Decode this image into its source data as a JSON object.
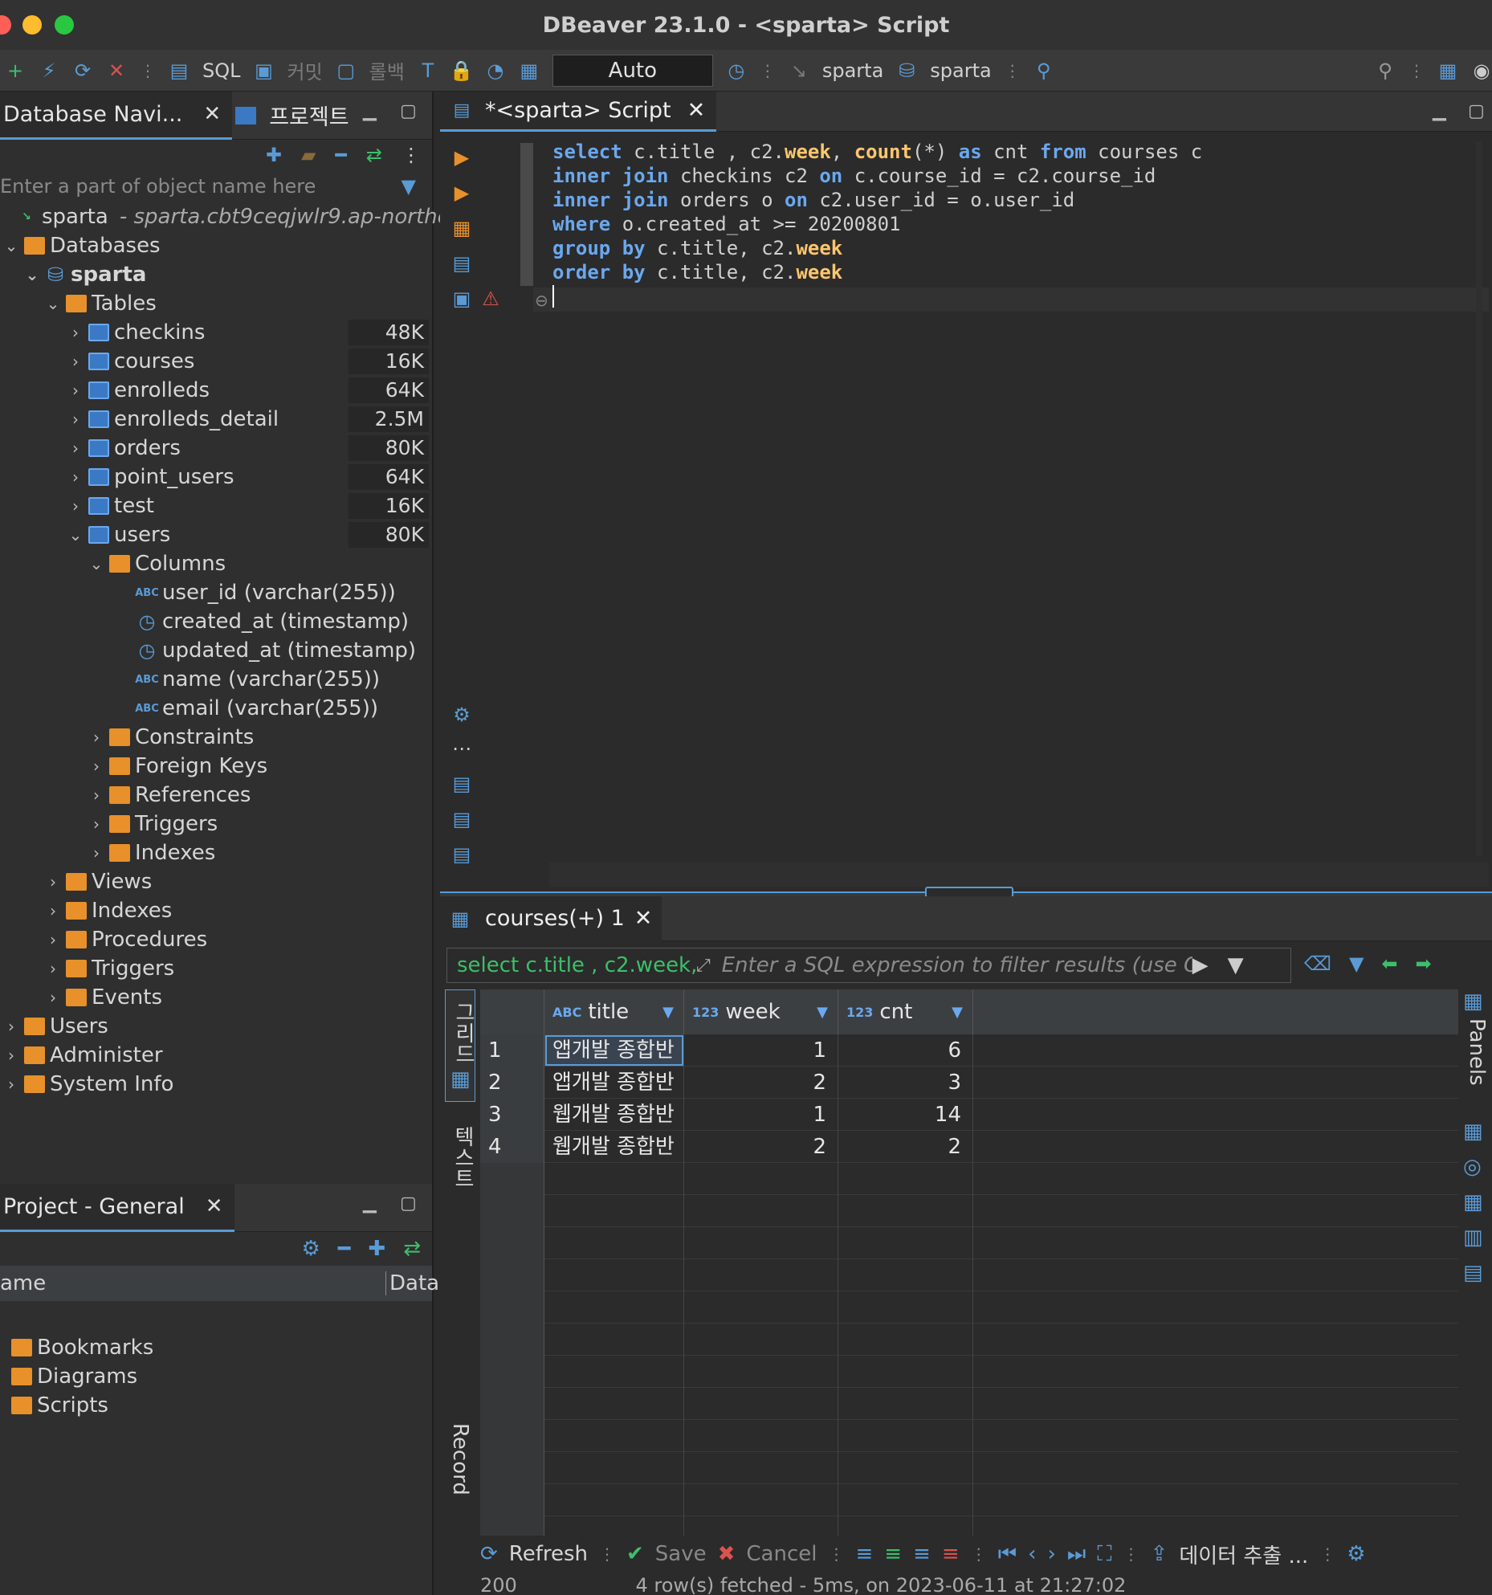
{
  "window": {
    "title": "DBeaver 23.1.0 - <sparta> Script"
  },
  "toolbar": {
    "sql_label": "SQL",
    "commit_label": "커밋",
    "rollback_label": "롤백",
    "tx_mode": "Auto",
    "datasource_1": "sparta",
    "datasource_2": "sparta"
  },
  "navigator": {
    "tab_label": "Database Navi...",
    "tab2_label": "프로젝트",
    "filter_placeholder": "Enter a part of object name here",
    "connection_name": "sparta",
    "connection_host": "- sparta.cbt9ceqjwlr9.ap-northe",
    "databases_label": "Databases",
    "db_name": "sparta",
    "tables_label": "Tables",
    "tables": [
      {
        "name": "checkins",
        "size": "48K"
      },
      {
        "name": "courses",
        "size": "16K"
      },
      {
        "name": "enrolleds",
        "size": "64K"
      },
      {
        "name": "enrolleds_detail",
        "size": "2.5M"
      },
      {
        "name": "orders",
        "size": "80K"
      },
      {
        "name": "point_users",
        "size": "64K"
      },
      {
        "name": "test",
        "size": "16K"
      },
      {
        "name": "users",
        "size": "80K"
      }
    ],
    "columns_label": "Columns",
    "columns": [
      "user_id (varchar(255))",
      "created_at (timestamp)",
      "updated_at (timestamp)",
      "name (varchar(255))",
      "email (varchar(255))"
    ],
    "table_subfolders": [
      "Constraints",
      "Foreign Keys",
      "References",
      "Triggers",
      "Indexes"
    ],
    "db_folders": [
      "Views",
      "Indexes",
      "Procedures",
      "Triggers",
      "Events"
    ],
    "top_folders": [
      "Users",
      "Administer",
      "System Info"
    ]
  },
  "project": {
    "tab_label": "Project - General",
    "col_name": "ame",
    "col_data": "Data",
    "items": [
      "Bookmarks",
      "Diagrams",
      "Scripts"
    ]
  },
  "editor": {
    "tab_label": "*<sparta> Script"
  },
  "results": {
    "tab_label": "courses(+) 1",
    "filter_sql": "select c.title , c2.week,",
    "filter_placeholder": "Enter a SQL expression to filter results (use Ctrl+",
    "columns": [
      {
        "name": "title",
        "type": "ABC"
      },
      {
        "name": "week",
        "type": "123"
      },
      {
        "name": "cnt",
        "type": "123"
      }
    ],
    "rows": [
      {
        "n": "1",
        "title": "앱개발 종합반",
        "week": "1",
        "cnt": "6"
      },
      {
        "n": "2",
        "title": "앱개발 종합반",
        "week": "2",
        "cnt": "3"
      },
      {
        "n": "3",
        "title": "웹개발 종합반",
        "week": "1",
        "cnt": "14"
      },
      {
        "n": "4",
        "title": "웹개발 종합반",
        "week": "2",
        "cnt": "2"
      }
    ],
    "side_grid": "그리드",
    "side_text": "텍스트",
    "side_record": "Record",
    "panels_label": "Panels",
    "refresh": "Refresh",
    "save": "Save",
    "cancel": "Cancel",
    "export": "데이터 추출 ...",
    "limit": "200",
    "status": "4 row(s) fetched - 5ms, on 2023-06-11 at 21:27:02"
  }
}
